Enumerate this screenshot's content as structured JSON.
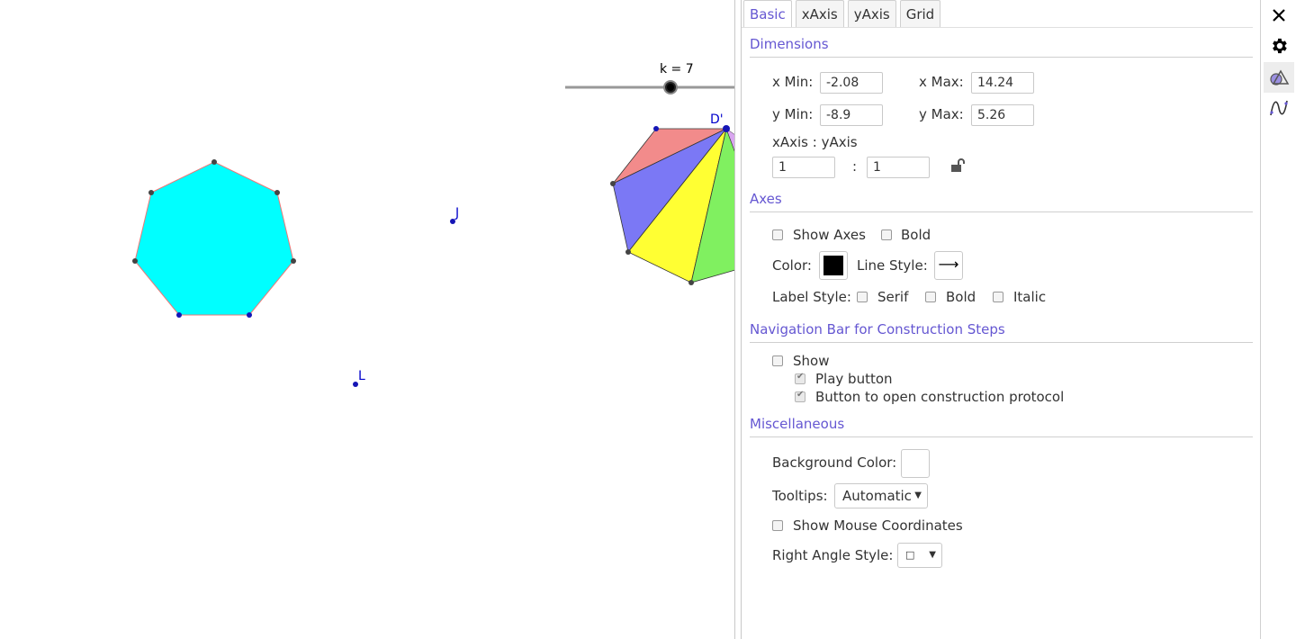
{
  "graphics": {
    "slider_label": "k = 7",
    "point_labels": {
      "J": "J",
      "L": "L",
      "Dp": "D'"
    },
    "colors": {
      "heptagon_fill": "#00ffff",
      "heptagon_edge": "#ff6b6b",
      "tri_red": "#f28b8b",
      "tri_blue": "#7b78f5",
      "tri_yellow": "#ffff33",
      "tri_green": "#80f060",
      "point_blue": "#1515b5",
      "point_dark": "#444444"
    }
  },
  "settings": {
    "tabs": [
      "Basic",
      "xAxis",
      "yAxis",
      "Grid"
    ],
    "active_tab": "Basic",
    "dimensions": {
      "heading": "Dimensions",
      "xmin_label": "x Min:",
      "xmin_value": "-2.08",
      "xmax_label": "x Max:",
      "xmax_value": "14.24",
      "ymin_label": "y Min:",
      "ymin_value": "-8.9",
      "ymax_label": "y Max:",
      "ymax_value": "5.26",
      "ratio_label": "xAxis : yAxis",
      "ratio_x": "1",
      "ratio_sep": ":",
      "ratio_y": "1"
    },
    "axes": {
      "heading": "Axes",
      "show_axes": "Show Axes",
      "bold": "Bold",
      "color_label": "Color:",
      "color_value": "#000000",
      "line_style_label": "Line Style:",
      "line_style_glyph": "⟶",
      "label_style_label": "Label Style:",
      "serif": "Serif",
      "label_bold": "Bold",
      "italic": "Italic"
    },
    "navigation": {
      "heading": "Navigation Bar for Construction Steps",
      "show": "Show",
      "play_button": "Play button",
      "protocol_button": "Button to open construction protocol"
    },
    "misc": {
      "heading": "Miscellaneous",
      "background_color_label": "Background Color:",
      "background_color_value": "#ffffff",
      "tooltips_label": "Tooltips:",
      "tooltips_value": "Automatic",
      "show_mouse_coords": "Show Mouse Coordinates",
      "right_angle_label": "Right Angle Style:",
      "right_angle_value": "□"
    }
  },
  "sidebar": {
    "close": "close-icon",
    "settings": "gear-icon",
    "graphics": "graphics-view-icon",
    "algebra": "function-graph-icon"
  }
}
